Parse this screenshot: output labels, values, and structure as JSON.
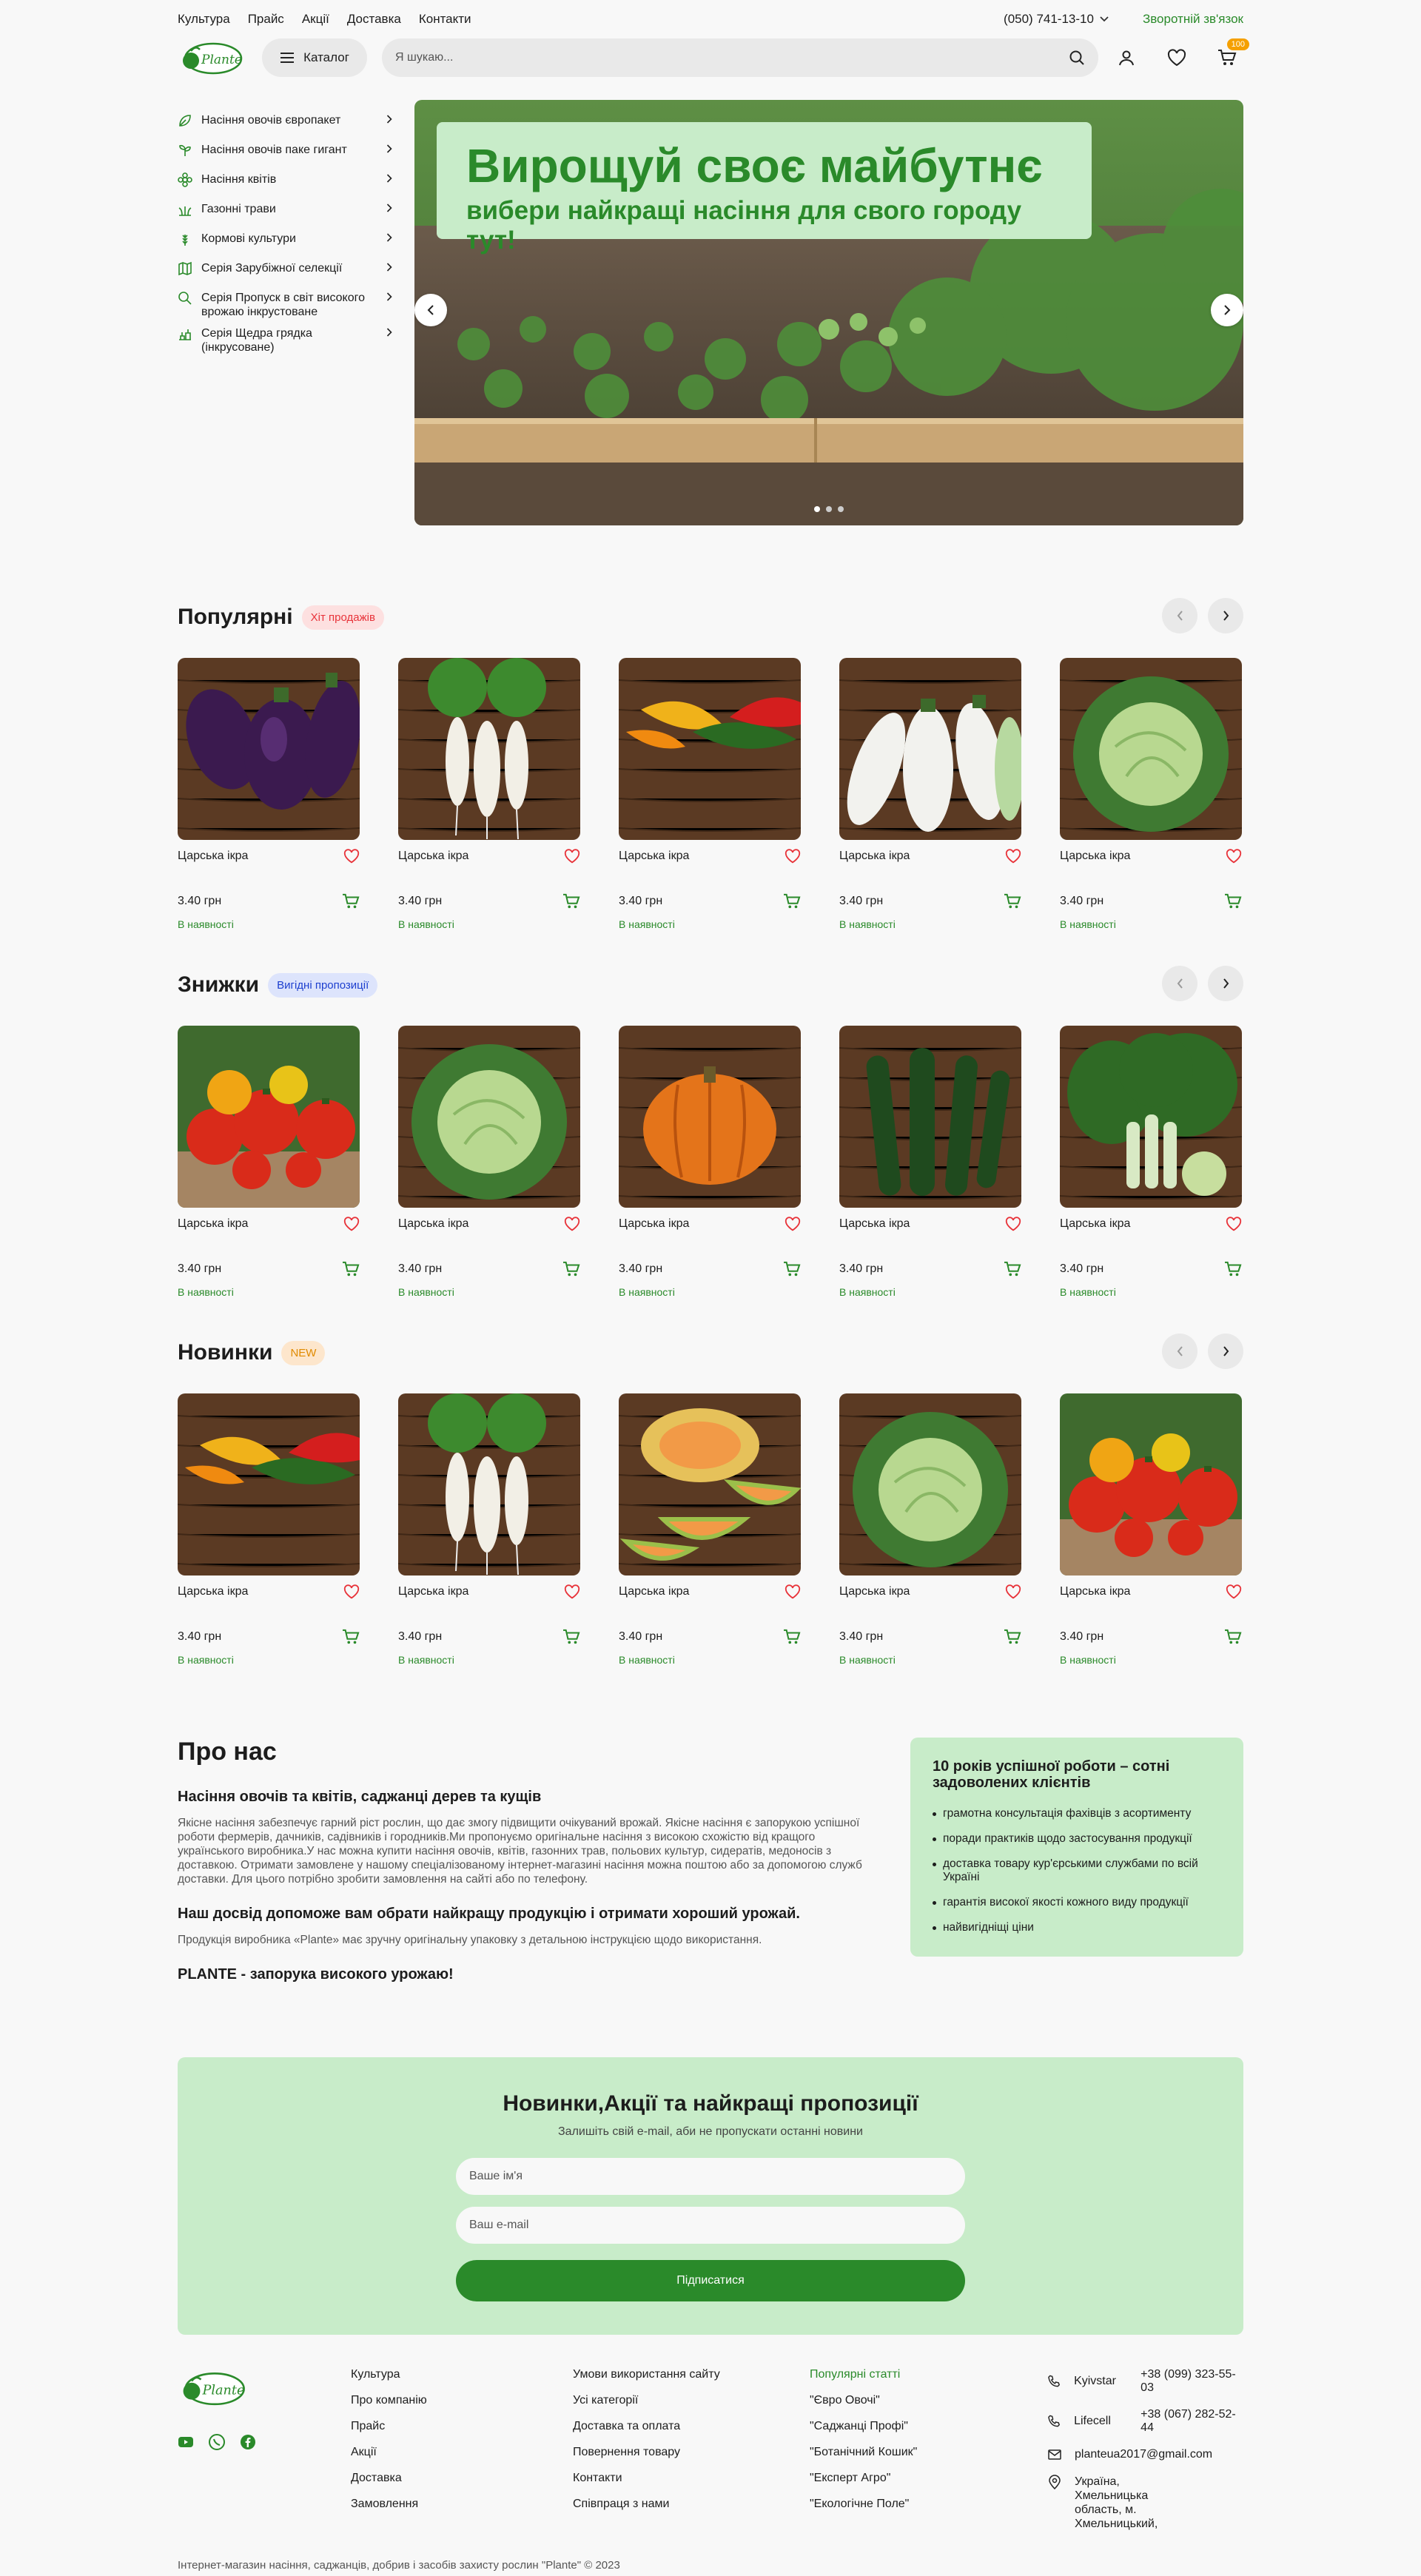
{
  "topbar": {
    "links": [
      "Культура",
      "Прайс",
      "Акції",
      "Доставка",
      "Контакти"
    ],
    "phone": "(050) 741-13-10",
    "feedback": "Зворотній зв'язок"
  },
  "header": {
    "logo_text": "Plante",
    "catalog_label": "Каталог",
    "search_placeholder": "Я шукаю...",
    "cart_count": "100"
  },
  "sidenav": [
    {
      "label": "Насіння овочів європакет",
      "icon": "leaf-icon"
    },
    {
      "label": "Насіння овочів паке гигант",
      "icon": "sprout-icon"
    },
    {
      "label": "Насіння квітів",
      "icon": "flower-icon"
    },
    {
      "label": "Газонні трави",
      "icon": "grass-icon"
    },
    {
      "label": "Кормові культури",
      "icon": "wheat-icon"
    },
    {
      "label": "Серія Зарубіжної селекції",
      "icon": "map-icon"
    },
    {
      "label": "Серія Пропуск в світ високого врожаю інкрустоване",
      "icon": "search-leaf-icon"
    },
    {
      "label": "Серія Щедра грядка (інкрусоване)",
      "icon": "garden-icon"
    }
  ],
  "hero": {
    "title": "Вирощуй своє майбутнє",
    "subtitle": "вибери найкращі насіння для свого городу тут!"
  },
  "sections": [
    {
      "title": "Популярні",
      "tag": "Хіт продажів",
      "tag_color": "#e8333a",
      "tag_bg": "#fde0e0",
      "products": [
        {
          "name": "Царська ікра",
          "price": "3.40 грн",
          "stock": "В наявності",
          "img": "eggplant"
        },
        {
          "name": "Царська ікра",
          "price": "3.40 грн",
          "stock": "В наявності",
          "img": "radish"
        },
        {
          "name": "Царська ікра",
          "price": "3.40 грн",
          "stock": "В наявності",
          "img": "peppers"
        },
        {
          "name": "Царська ікра",
          "price": "3.40 грн",
          "stock": "В наявності",
          "img": "white-eggplant"
        },
        {
          "name": "Царська ікра",
          "price": "3.40 грн",
          "stock": "В наявності",
          "img": "cabbage"
        }
      ]
    },
    {
      "title": "Знижки",
      "tag": "Вигідні пропозиції",
      "tag_color": "#1d3fcf",
      "tag_bg": "#dde4fc",
      "products": [
        {
          "name": "Царська ікра",
          "price": "3.40 грн",
          "stock": "В наявності",
          "img": "tomatoes"
        },
        {
          "name": "Царська ікра",
          "price": "3.40 грн",
          "stock": "В наявності",
          "img": "cabbage"
        },
        {
          "name": "Царська ікра",
          "price": "3.40 грн",
          "stock": "В наявності",
          "img": "pumpkin"
        },
        {
          "name": "Царська ікра",
          "price": "3.40 грн",
          "stock": "В наявності",
          "img": "cucumbers"
        },
        {
          "name": "Царська ікра",
          "price": "3.40 грн",
          "stock": "В наявності",
          "img": "bokchoy"
        }
      ]
    },
    {
      "title": "Новинки",
      "tag": "NEW",
      "tag_color": "#e08a00",
      "tag_bg": "#fde6cc",
      "products": [
        {
          "name": "Царська ікра",
          "price": "3.40 грн",
          "stock": "В наявності",
          "img": "peppers"
        },
        {
          "name": "Царська ікра",
          "price": "3.40 грн",
          "stock": "В наявності",
          "img": "radish"
        },
        {
          "name": "Царська ікра",
          "price": "3.40 грн",
          "stock": "В наявності",
          "img": "melon"
        },
        {
          "name": "Царська ікра",
          "price": "3.40 грн",
          "stock": "В наявності",
          "img": "cabbage"
        },
        {
          "name": "Царська ікра",
          "price": "3.40 грн",
          "stock": "В наявності",
          "img": "tomatoes"
        }
      ]
    }
  ],
  "about": {
    "title": "Про нас",
    "h1": "Насіння овочів та квітів, саджанці дерев та кущів",
    "p1": "Якісне насіння забезпечує гарний ріст рослин, що дає змогу підвищити очікуваний врожай. Якісне насіння є запорукою успішної роботи фермерів, дачників, садівників і городників.Ми пропонуємо оригінальне насіння з високою схожістю від кращого українського виробника.У нас можна купити насіння овочів, квітів, газонних трав, польових культур, сидератів, медоносів з доставкою. Отримати замовлене у нашому спеціалізованому інтернет-магазині насіння можна поштою або за допомогою служб доставки. Для цього потрібно зробити замовлення на сайті або по телефону.",
    "h2": "Наш досвід допоможе вам обрати найкращу продукцію і отримати хороший урожай.",
    "p2": "Продукція виробника «Plante» має зручну оригінальну упаковку з детальною інструкцією щодо використання.",
    "h3": "PLANTE - запорука високого урожаю!",
    "box_title": "10 років успішної роботи – сотні задоволених клієнтів",
    "box_items": [
      "грамотна консультація фахівців з асортименту",
      "поради практиків щодо застосування продукції",
      "доставка товару кур'єрськими службами по всій Україні",
      "гарантія високої якості кожного виду продукції",
      "найвигідніщі ціни"
    ]
  },
  "newsletter": {
    "title": "Новинки,Акції та найкращі пропозиції",
    "subtitle": "Залишіть свій e-mail, аби не пропускати останні новини",
    "name_placeholder": "Ваше  ім'я",
    "email_placeholder": "Ваш e-mail",
    "button": "Підписатися"
  },
  "footer": {
    "col1": [
      "Культура",
      "Про компанію",
      "Прайс",
      "Акції",
      "Доставка",
      "Замовлення"
    ],
    "col2": [
      "Умови використання сайту",
      "Усі категорії",
      "Доставка та оплата",
      "Повернення товару",
      "Контакти",
      "Співпраця з нами"
    ],
    "col3_title": "Популярні статті",
    "col3": [
      "\"Євро Овочі\"",
      "\"Саджанці Профі\"",
      "\"Ботанічний Кошик\"",
      "\"Експерт Агро\"",
      "\"Екологічне Поле\""
    ],
    "contacts": [
      {
        "label": "Kyivstar",
        "value": "+38 (099) 323-55-03"
      },
      {
        "label": "Lifecell",
        "value": "+38 (067) 282-52-44"
      }
    ],
    "email": "planteua2017@gmail.com",
    "address": "Україна, Хмельницька область, м. Хмельницький,",
    "copyright": "Інтернет-магазин насіння, саджанців, добрив і засобів захисту рослин \"Plante\" © 2023"
  },
  "colors": {
    "accent": "#2a8a2a",
    "light_green": "#c8ecc9",
    "badge": "#f5a000"
  }
}
